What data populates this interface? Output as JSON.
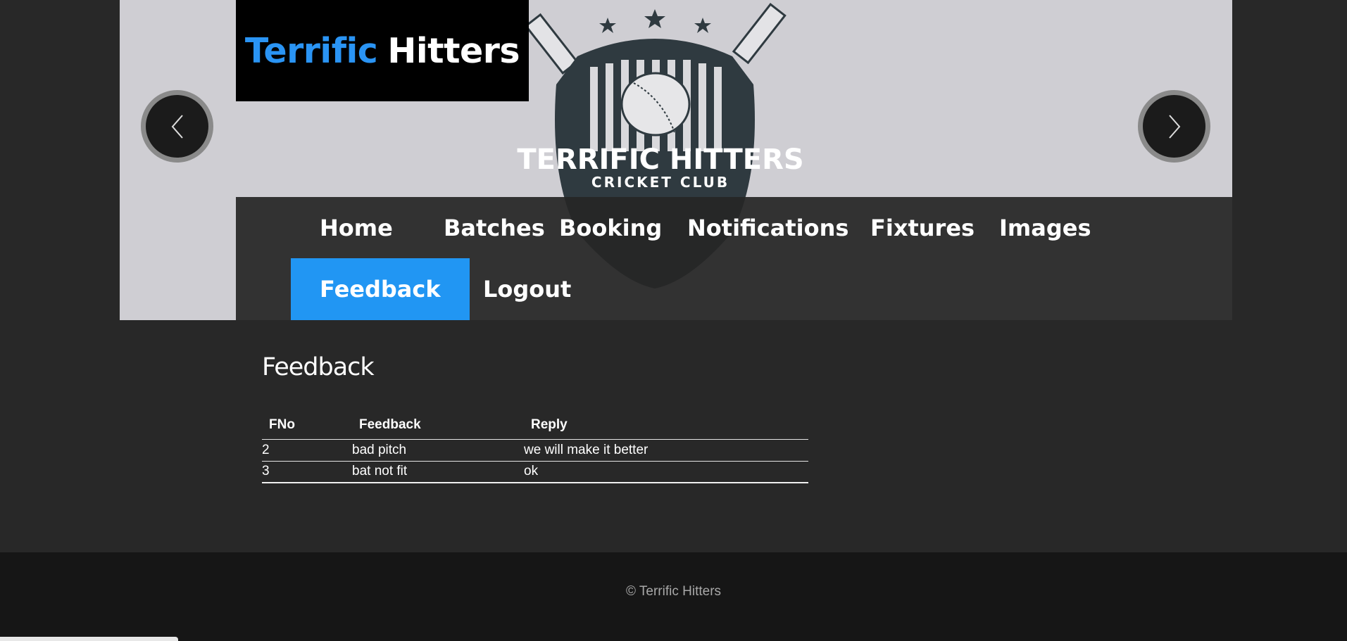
{
  "logo": {
    "word1": "Terrific",
    "word2": "Hitters"
  },
  "banner": {
    "crest_line1": "TERRIFIC HITTERS",
    "crest_line2": "CRICKET CLUB"
  },
  "nav": {
    "items": [
      {
        "label": "Home"
      },
      {
        "label": "Batches"
      },
      {
        "label": "Booking"
      },
      {
        "label": "Notifications"
      },
      {
        "label": "Fixtures"
      },
      {
        "label": "Images"
      },
      {
        "label": "Feedback",
        "active": true
      },
      {
        "label": "Logout"
      }
    ]
  },
  "main": {
    "title": "Feedback",
    "table": {
      "headers": [
        "FNo",
        "Feedback",
        "Reply"
      ],
      "rows": [
        [
          "2",
          "bad pitch",
          "we will make it better"
        ],
        [
          "3",
          "bat not fit",
          "ok"
        ]
      ]
    }
  },
  "footer": {
    "text": "© Terrific Hitters"
  },
  "colors": {
    "accent": "#2196f3",
    "logo_blue": "#2a94f4",
    "page_bg": "#282828",
    "footer_bg": "#161616"
  }
}
